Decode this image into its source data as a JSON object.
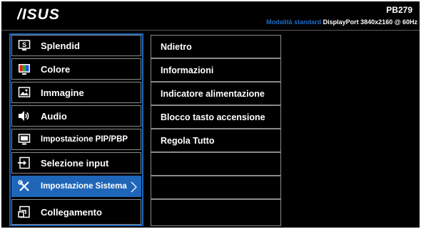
{
  "header": {
    "brand": "ASUS",
    "model": "PB279",
    "mode": "Modalità standard",
    "input": "DisplayPort",
    "resolution": "3840x2160 @ 60Hz"
  },
  "colors": {
    "accent": "#1f66b8",
    "mode_text": "#1e6bc4",
    "background": "#000000",
    "border": "#8a8a8a"
  },
  "main_menu": [
    {
      "label": "Splendid",
      "icon": "splendid-icon",
      "selected": false
    },
    {
      "label": "Colore",
      "icon": "color-palette-icon",
      "selected": false
    },
    {
      "label": "Immagine",
      "icon": "image-icon",
      "selected": false
    },
    {
      "label": "Audio",
      "icon": "speaker-icon",
      "selected": false
    },
    {
      "label": "Impostazione PIP/PBP",
      "icon": "pip-monitor-icon",
      "selected": false
    },
    {
      "label": "Selezione input",
      "icon": "input-select-icon",
      "selected": false
    },
    {
      "label": "Impostazione Sistema",
      "icon": "tools-icon",
      "selected": true
    },
    {
      "label": "Collegamento",
      "icon": "shortcut-icon",
      "selected": false
    }
  ],
  "submenu": [
    {
      "label": "Ndietro"
    },
    {
      "label": "Informazioni"
    },
    {
      "label": "Indicatore alimentazione"
    },
    {
      "label": "Blocco tasto accensione"
    },
    {
      "label": "Regola Tutto"
    },
    {
      "label": ""
    },
    {
      "label": ""
    },
    {
      "label": ""
    }
  ]
}
